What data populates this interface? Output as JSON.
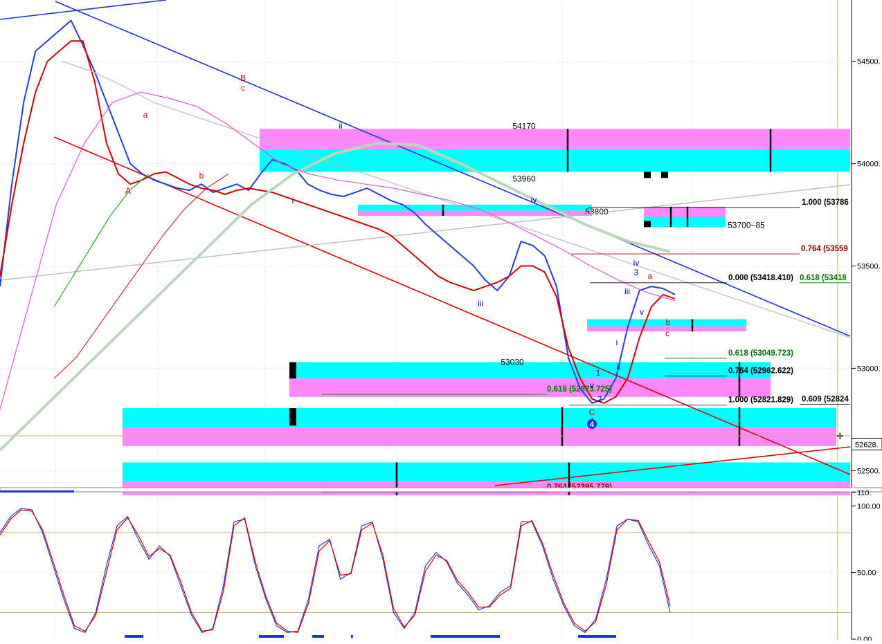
{
  "chart_data": [
    {
      "type": "line",
      "panel": "price",
      "title": "",
      "xlabel": "",
      "ylabel": "",
      "ylim": [
        52420,
        54800
      ],
      "grid": true,
      "y_ticks": [
        {
          "value": 54500,
          "label": "54500."
        },
        {
          "value": 54000,
          "label": "54000."
        },
        {
          "value": 53500,
          "label": "53500."
        },
        {
          "value": 53000,
          "label": "53000."
        },
        {
          "value": 52500,
          "label": "52500."
        }
      ],
      "current_price_label": "52628.",
      "current_price": 52628,
      "series": [
        {
          "color": "#1e3fd0",
          "values": [
            53400,
            53900,
            54300,
            54550,
            54600,
            54650,
            54700,
            54580,
            54450,
            54300,
            54150,
            54000,
            53950,
            53920,
            53900,
            53880,
            53870,
            53900,
            53860,
            53880,
            53900,
            53870,
            53950,
            54020,
            54000,
            53970,
            53900,
            53870,
            53850,
            53840,
            53860,
            53880,
            53850,
            53820,
            53800,
            53760,
            53700,
            53650,
            53600,
            53550,
            53500,
            53430,
            53380,
            53450,
            53620,
            53600,
            53550,
            53400,
            53050,
            52900,
            52830,
            52850,
            52950,
            53200,
            53380,
            53400,
            53390,
            53360
          ]
        },
        {
          "color": "#cc0000",
          "values": [
            53450,
            53800,
            54100,
            54350,
            54500,
            54550,
            54600,
            54600,
            54400,
            54100,
            53950,
            53900,
            53920,
            53950,
            53960,
            53930,
            53900,
            53880,
            53870,
            53850,
            53870,
            53880,
            53870,
            53860,
            53840,
            53820,
            53800,
            53780,
            53760,
            53740,
            53720,
            53700,
            53680,
            53650,
            53600,
            53550,
            53500,
            53450,
            53420,
            53400,
            53380,
            53400,
            53420,
            53450,
            53500,
            53500,
            53470,
            53350,
            53100,
            52950,
            52850,
            52830,
            52860,
            52950,
            53150,
            53300,
            53360,
            53340
          ]
        },
        {
          "color": "#bbbbbb",
          "values": [
            54500,
            54450,
            54380,
            54300,
            54250,
            54200,
            54150,
            54100,
            54050,
            54000,
            53950,
            53900,
            53850,
            53800,
            53750,
            53700,
            53650,
            53600,
            53550,
            53500,
            53450,
            53400,
            53350,
            53300,
            53250,
            53200,
            53150
          ]
        },
        {
          "color": "#b9d8b9",
          "values": [
            52600,
            52800,
            53000,
            53200,
            53400,
            53600,
            53800,
            53950,
            54050,
            54100,
            54090,
            54000,
            53900,
            53800,
            53700,
            53620,
            53570
          ]
        },
        {
          "color": "#dd55dd",
          "values": [
            52800,
            53300,
            53800,
            54100,
            54300,
            54350,
            54320,
            54280,
            54200,
            54100,
            54000,
            53950,
            53920,
            53900,
            53880,
            53850,
            53820,
            53780,
            53720,
            53650,
            53580,
            53500,
            53430,
            53370,
            53330
          ]
        },
        {
          "color": "#22aa22",
          "values": [
            53300,
            53450,
            53600,
            53750,
            53870,
            53950
          ]
        },
        {
          "color": "#cc3333",
          "values": [
            52950,
            53050,
            53200,
            53350,
            53500,
            53650,
            53780,
            53880,
            53950
          ]
        }
      ],
      "zones": [
        {
          "label": "54170",
          "value": 54170
        },
        {
          "label": "53960",
          "value": 53960
        },
        {
          "label": "53800",
          "value": 53800
        },
        {
          "label": "53700−85",
          "value": 53700
        },
        {
          "label": "53030",
          "value": 53030
        }
      ],
      "fib_levels": [
        {
          "label": "1.000  (53786",
          "value": 53786,
          "color": "#000000"
        },
        {
          "label": "0.764  (53559",
          "value": 53559,
          "color": "#8b0000"
        },
        {
          "label": "0.000  (53418.410)",
          "value": 53418,
          "color": "#000000"
        },
        {
          "label": "0.618  (53418",
          "value": 53418,
          "color": "#007700"
        },
        {
          "label": "0.618  (53049.723)",
          "value": 53049,
          "color": "#007700"
        },
        {
          "label": "0.764  (52962.622)",
          "value": 52962,
          "color": "#000000"
        },
        {
          "label": "0.618  (52873.725)",
          "value": 52873,
          "color": "#007700"
        },
        {
          "label": "1.000  (52821.829)",
          "value": 52821,
          "color": "#000000"
        },
        {
          "label": "0.609  (52824",
          "value": 52824,
          "color": "#000000"
        },
        {
          "label": "0.764  (52395.779)",
          "value": 52395,
          "color": "#8b0000"
        }
      ],
      "wave_labels": [
        {
          "text": "A",
          "color": "#cc0000"
        },
        {
          "text": "a",
          "color": "#cc0000"
        },
        {
          "text": "b",
          "color": "#cc0000"
        },
        {
          "text": "B",
          "color": "#cc0000"
        },
        {
          "text": "c",
          "color": "#cc0000"
        },
        {
          "text": "i",
          "color": "#0000aa"
        },
        {
          "text": "ii",
          "color": "#0000aa"
        },
        {
          "text": "iii",
          "color": "#0000aa"
        },
        {
          "text": "iv",
          "color": "#0000aa"
        },
        {
          "text": "v",
          "color": "#0000aa"
        },
        {
          "text": "C",
          "color": "#cc0000"
        },
        {
          "text": "1",
          "color": "#0000aa"
        },
        {
          "text": "2",
          "color": "#0000aa"
        },
        {
          "text": "i",
          "color": "#0000aa"
        },
        {
          "text": "ii",
          "color": "#0000aa"
        },
        {
          "text": "iii",
          "color": "#0000aa"
        },
        {
          "text": "iv",
          "color": "#0000aa"
        },
        {
          "text": "3",
          "color": "#0000aa"
        },
        {
          "text": "v",
          "color": "#0000aa"
        },
        {
          "text": "a",
          "color": "#cc0000"
        },
        {
          "text": "b",
          "color": "#cc0000"
        },
        {
          "text": "c",
          "color": "#cc0000"
        },
        {
          "text": "4",
          "color": "#0000aa"
        },
        {
          "text": "4",
          "color": "#ffffff"
        }
      ]
    },
    {
      "type": "line",
      "panel": "oscillator",
      "title": "",
      "xlabel": "",
      "ylabel": "",
      "ylim": [
        0,
        110
      ],
      "grid": true,
      "y_ticks": [
        {
          "value": 110,
          "label": "110."
        },
        {
          "value": 100,
          "label": "100.00"
        },
        {
          "value": 50,
          "label": "50.00"
        },
        {
          "value": 0,
          "label": "0.00"
        }
      ],
      "reference_levels": [
        80,
        20
      ],
      "series": [
        {
          "color": "#1e3fd0",
          "values": [
            80,
            92,
            98,
            97,
            80,
            55,
            30,
            8,
            5,
            20,
            55,
            85,
            92,
            75,
            60,
            70,
            62,
            40,
            18,
            5,
            8,
            40,
            88,
            90,
            55,
            30,
            10,
            5,
            6,
            30,
            70,
            75,
            45,
            50,
            85,
            88,
            60,
            20,
            8,
            20,
            55,
            65,
            58,
            42,
            33,
            22,
            25,
            35,
            40,
            88,
            88,
            70,
            45,
            25,
            10,
            5,
            15,
            45,
            85,
            90,
            88,
            70,
            55,
            20
          ]
        },
        {
          "color": "#cc0000",
          "values": [
            78,
            90,
            97,
            96,
            82,
            58,
            33,
            10,
            6,
            18,
            50,
            82,
            91,
            78,
            62,
            68,
            63,
            43,
            20,
            6,
            7,
            36,
            85,
            91,
            58,
            32,
            12,
            6,
            5,
            27,
            66,
            74,
            48,
            49,
            82,
            87,
            63,
            23,
            9,
            18,
            51,
            63,
            59,
            44,
            35,
            24,
            24,
            33,
            38,
            85,
            89,
            72,
            48,
            27,
            12,
            6,
            13,
            41,
            82,
            90,
            89,
            73,
            58,
            25
          ]
        }
      ]
    }
  ]
}
